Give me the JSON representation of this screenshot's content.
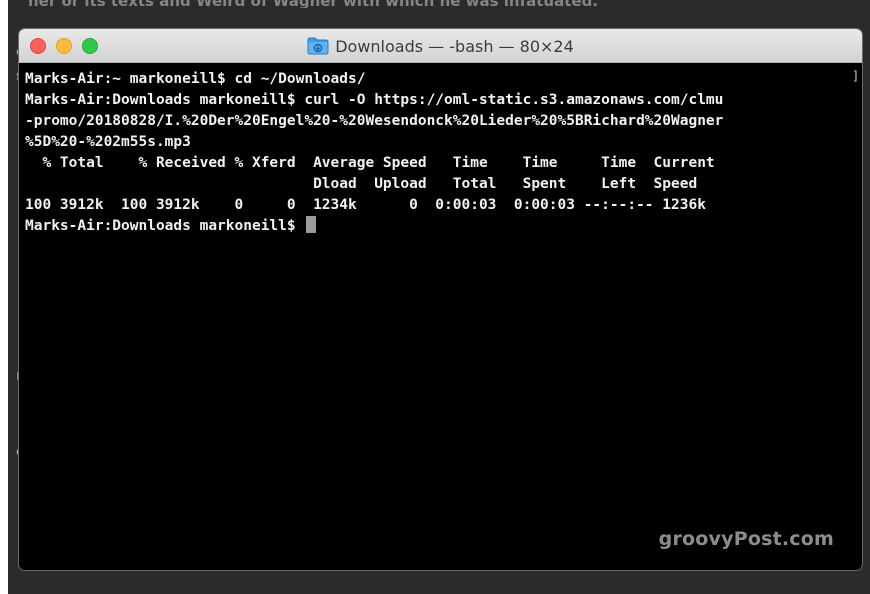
{
  "desktop": {
    "top_text": "ner or its texts and Weird of Wagner with which he was infatuated.",
    "edge_glyphs": [
      "o",
      "s",
      "r",
      "c"
    ]
  },
  "window": {
    "title": "Downloads — -bash — 80×24",
    "folder_icon": "folder-icon",
    "traffic_lights": {
      "close": "#fc605b",
      "minimize": "#fdbc40",
      "zoom": "#34c84a"
    }
  },
  "terminal": {
    "lines": [
      "Marks-Air:~ markoneill$ cd ~/Downloads/",
      "Marks-Air:Downloads markoneill$ curl -O https://oml-static.s3.amazonaws.com/clmu",
      "-promo/20180828/I.%20Der%20Engel%20-%20Wesendonck%20Lieder%20%5BRichard%20Wagner",
      "%5D%20-%202m55s.mp3",
      "  % Total    % Received % Xferd  Average Speed   Time    Time     Time  Current",
      "                                 Dload  Upload   Total   Spent    Left  Speed",
      "100 3912k  100 3912k    0     0  1234k      0  0:00:03  0:00:03 --:--:-- 1236k",
      "Marks-Air:Downloads markoneill$ "
    ],
    "text_color": "#f2f2f2",
    "background": "#000000"
  },
  "watermark": "groovyPost.com"
}
